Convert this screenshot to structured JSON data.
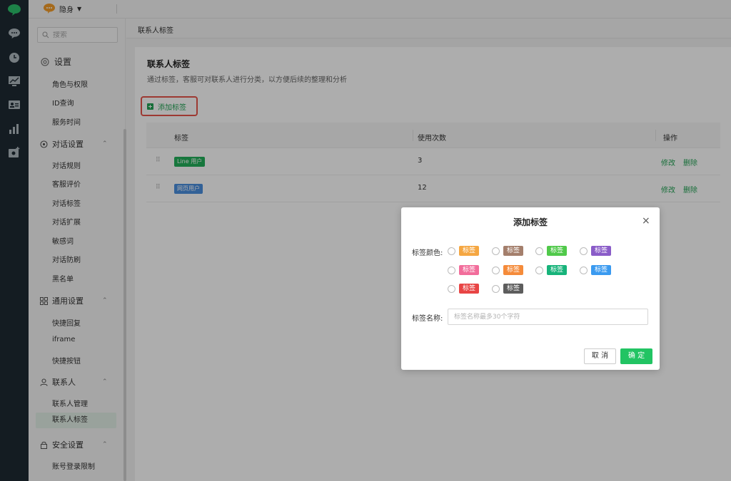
{
  "colors": {
    "rail": "#1e2a33",
    "accent": "#23a355",
    "ok_button": "#22c463",
    "highlight_border": "#e8554a",
    "active_item_bg": "#e2efe6"
  },
  "topbar": {
    "status_label": "隐身",
    "status_caret": "▼"
  },
  "sidebar": {
    "search_placeholder": "搜索",
    "settings_label": "设置",
    "items_top": [
      "角色与权限",
      "ID查询",
      "服务时间"
    ],
    "groups": [
      {
        "label": "对话设置",
        "icon": "chat-settings-icon",
        "items": [
          "对话规则",
          "客服评价",
          "对话标签",
          "对话扩展",
          "敏感词",
          "对话防刷",
          "黑名单"
        ]
      },
      {
        "label": "通用设置",
        "icon": "grid-icon",
        "items": [
          "快捷回复",
          "iframe",
          "快捷按钮"
        ]
      },
      {
        "label": "联系人",
        "icon": "person-icon",
        "items": [
          "联系人管理",
          "联系人标签"
        ]
      },
      {
        "label": "安全设置",
        "icon": "lock-icon",
        "items": [
          "账号登录限制"
        ]
      }
    ],
    "active_item": "联系人标签",
    "chevron": "⌃"
  },
  "breadcrumb": "联系人标签",
  "main": {
    "title": "联系人标签",
    "description": "通过标签，客服可对联系人进行分类，以方便后续的整理和分析",
    "add_button": "添加标签",
    "columns": [
      "标签",
      "使用次数",
      "操作"
    ],
    "rows": [
      {
        "tag": "Line 用户",
        "tag_color": "#23b05a",
        "count": "3",
        "edit": "修改",
        "delete": "删除"
      },
      {
        "tag": "网页用户",
        "tag_color": "#4a8fdf",
        "count": "12",
        "edit": "修改",
        "delete": "删除"
      }
    ]
  },
  "modal": {
    "title": "添加标签",
    "close": "×",
    "color_label": "标签颜色:",
    "name_label": "标签名称:",
    "name_placeholder": "标签名称最多30个字符",
    "chip_text": "标签",
    "chip_colors": [
      "#f5a742",
      "#a47f6c",
      "#50c94a",
      "#8a5cc8",
      "#f26d9b",
      "#f58b3a",
      "#17b37a",
      "#3a9af0",
      "#e84444",
      "#5d5d5d"
    ],
    "cancel": "取 消",
    "ok": "确 定"
  }
}
